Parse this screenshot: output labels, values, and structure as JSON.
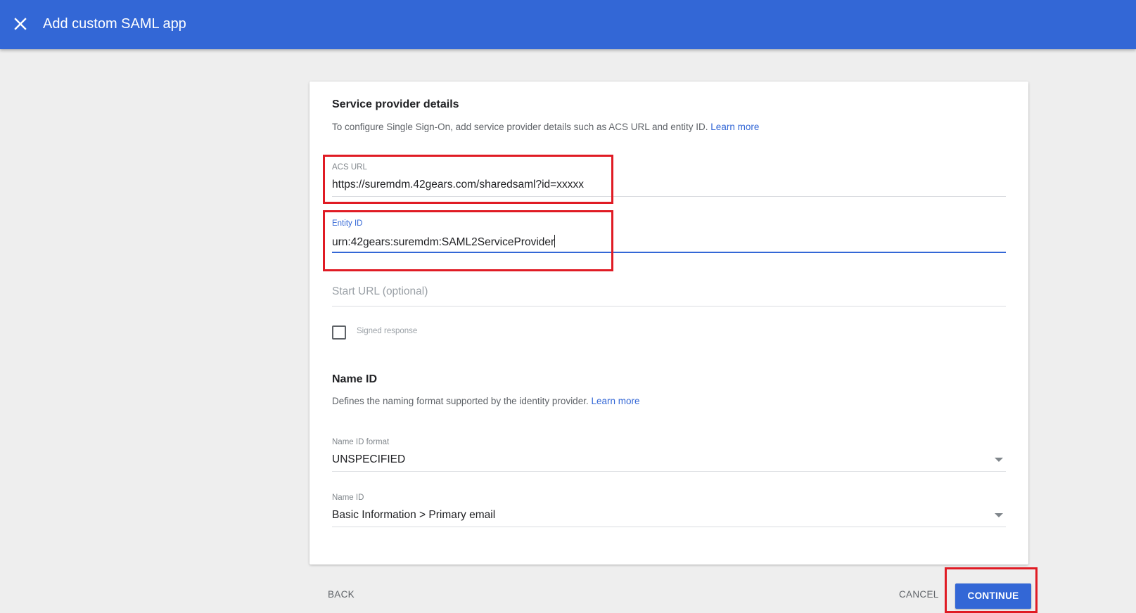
{
  "header": {
    "title": "Add custom SAML app",
    "close_icon": "close-icon"
  },
  "service_provider": {
    "title": "Service provider details",
    "description": "To configure Single Sign-On, add service provider details such as ACS URL and entity ID.",
    "learn_more": "Learn more",
    "acs_url": {
      "label": "ACS URL",
      "value": "https://suremdm.42gears.com/sharedsaml?id=xxxxx"
    },
    "entity_id": {
      "label": "Entity ID",
      "value": "urn:42gears:suremdm:SAML2ServiceProvider"
    },
    "start_url": {
      "placeholder": "Start URL (optional)"
    },
    "signed_response": {
      "label": "Signed response",
      "checked": false
    }
  },
  "name_id": {
    "title": "Name ID",
    "description": "Defines the naming format supported by the identity provider.",
    "learn_more": "Learn more",
    "format": {
      "label": "Name ID format",
      "value": "UNSPECIFIED"
    },
    "name_id_field": {
      "label": "Name ID",
      "value": "Basic Information > Primary email"
    }
  },
  "footer": {
    "back_label": "BACK",
    "cancel_label": "CANCEL",
    "continue_label": "CONTINUE"
  },
  "colors": {
    "brand": "#3367d6",
    "highlight": "#e01b24",
    "background": "#eeeeee"
  }
}
